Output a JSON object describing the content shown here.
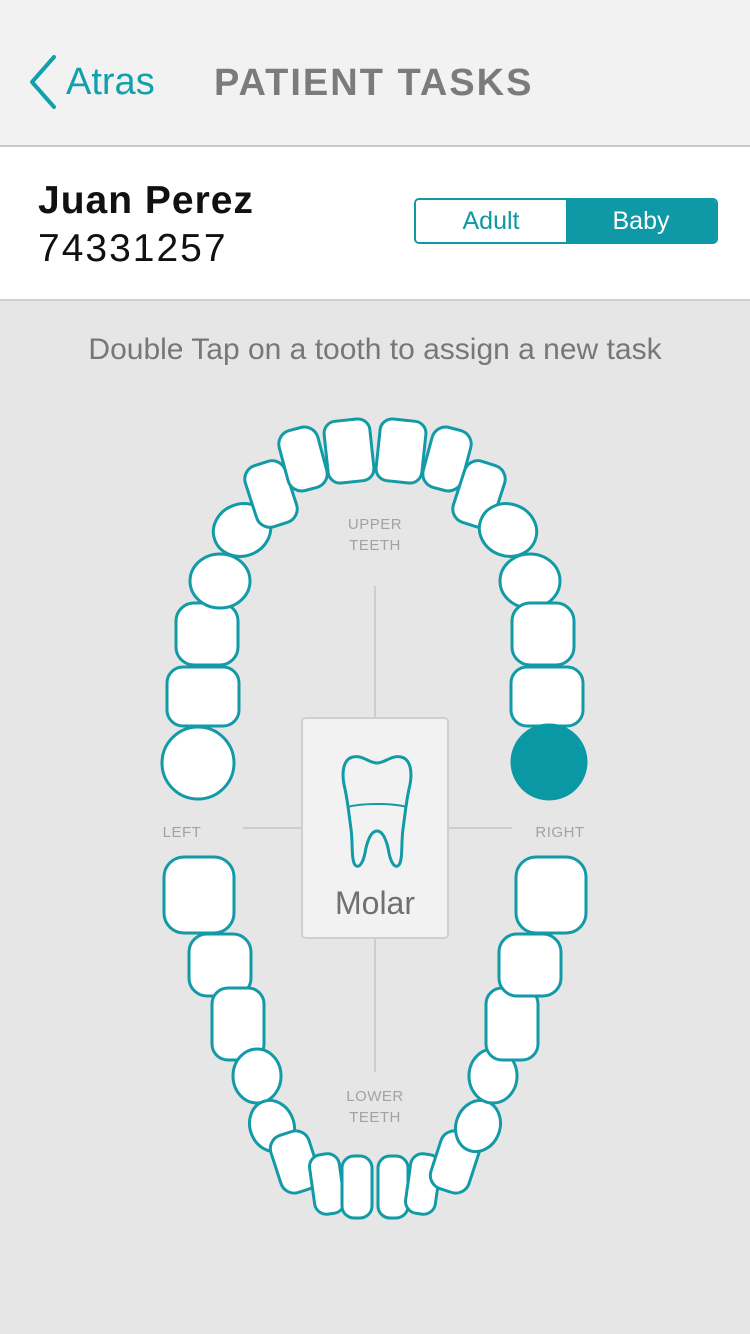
{
  "nav": {
    "back_label": "Atras",
    "title": "PATIENT TASKS"
  },
  "patient": {
    "name": "Juan Perez",
    "id": "74331257"
  },
  "segment": {
    "options": [
      "Adult",
      "Baby"
    ],
    "selected": "Baby"
  },
  "instruction": "Double Tap on a tooth to assign a new task",
  "chart": {
    "upper_label_1": "UPPER",
    "upper_label_2": "TEETH",
    "lower_label_1": "LOWER",
    "lower_label_2": "TEETH",
    "left_label": "LEFT",
    "right_label": "RIGHT"
  },
  "selected_tooth": {
    "type": "Molar"
  },
  "colors": {
    "accent": "#0f98a5",
    "tooth_outline": "#129aa7",
    "selected_fill": "#0a98a4"
  }
}
